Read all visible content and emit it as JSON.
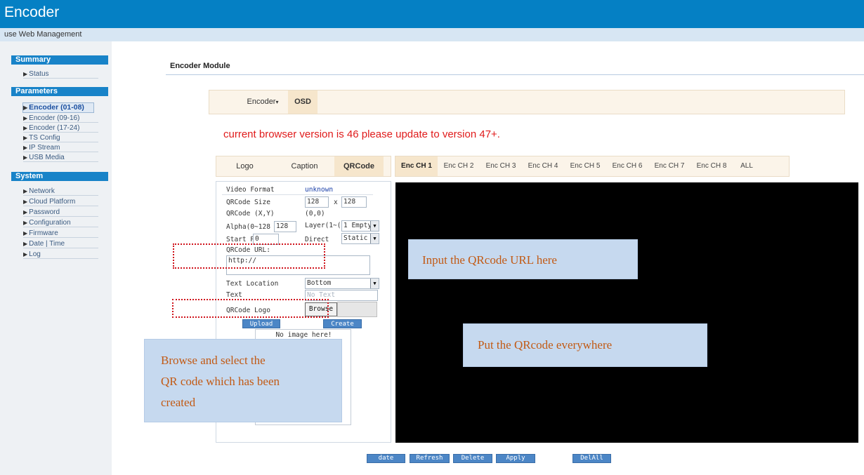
{
  "header": {
    "title": "Encoder",
    "subtitle": "use Web Management"
  },
  "sidebar": {
    "sections": {
      "summary": "Summary",
      "parameters": "Parameters",
      "system": "System"
    },
    "summary_items": [
      "Status"
    ],
    "parameter_items": [
      "Encoder (01-08)",
      "Encoder (09-16)",
      "Encoder (17-24)",
      "TS Config",
      "IP Stream",
      "USB Media"
    ],
    "system_items": [
      "Network",
      "Cloud Platform",
      "Password",
      "Configuration",
      "Firmware",
      "Date | Time",
      "Log"
    ]
  },
  "main": {
    "module_title": "Encoder Module",
    "tabs": [
      "Encoder",
      "OSD"
    ],
    "warning": "current browser version is 46 please update to version 47+.",
    "osd_tabs": [
      "Logo",
      "Caption",
      "QRCode"
    ],
    "channels": [
      "Enc CH 1",
      "Enc CH 2",
      "Enc CH 3",
      "Enc CH 4",
      "Enc CH 5",
      "Enc CH 6",
      "Enc CH 7",
      "Enc CH 8",
      "ALL"
    ]
  },
  "form": {
    "video_format_label": "Video Format",
    "video_format_value": "unknown",
    "size_label": "QRCode Size",
    "size_w": "128",
    "size_x": "x",
    "size_h": "128",
    "xy_label": "QRCode (X,Y)",
    "xy_value": "(0,0)",
    "alpha_label": "Alpha(0~128",
    "alpha_value": "128",
    "layer_label": "Layer(1~(",
    "layer_value": "1 Empty",
    "start_pos_label": "Start Pos",
    "start_pos_value": "0",
    "direct_label": "Direct",
    "direct_value": "Static",
    "url_label": "QRCode URL:",
    "url_value": "http://",
    "text_location_label": "Text Location",
    "text_location_value": "Bottom",
    "text_label": "Text",
    "text_placeholder": "No Text",
    "logo_label": "QRCode Logo",
    "browse_label": "Browse",
    "upload_label": "Upload",
    "create_label": "Create",
    "no_image": "No image here!"
  },
  "callouts": {
    "url": "Input the QRcode URL here",
    "everywhere": "Put the QRcode everywhere",
    "browse_line1": "Browse and select the",
    "browse_line2": "QR code which has been",
    "browse_line3": "created"
  },
  "bottom_buttons": [
    "date",
    "Refresh",
    "Delete",
    "Apply",
    "DelAll"
  ],
  "colors": {
    "header": "#0580c4",
    "sidebar_head": "#1883c8",
    "warning": "#e01b1b",
    "callout_bg": "#c6d9ef",
    "callout_text": "#c25a14",
    "highlight": "#d0141c"
  }
}
